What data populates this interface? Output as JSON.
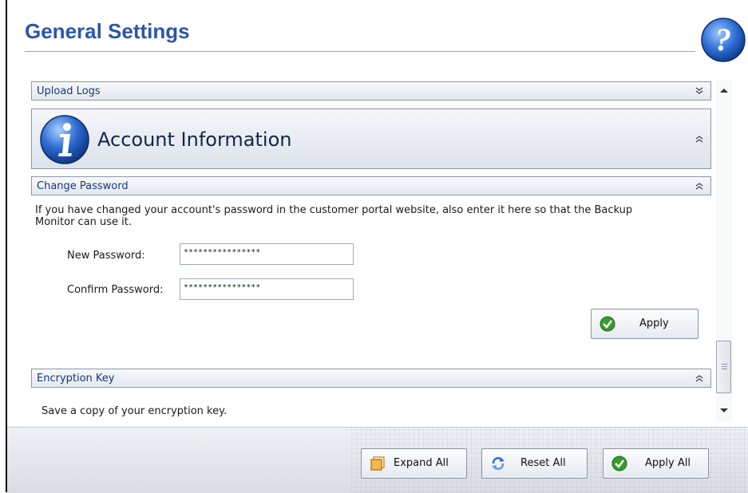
{
  "page": {
    "title": "General Settings"
  },
  "sections": {
    "upload_logs": {
      "label": "Upload Logs"
    },
    "account_info": {
      "label": "Account Information"
    },
    "change_password": {
      "label": "Change Password",
      "description_line1": "If you have changed your account's password in the customer portal website, also enter it here so that the Backup",
      "description_line2": "Monitor can use it.",
      "new_password_label": "New Password:",
      "new_password_value": "****************",
      "confirm_password_label": "Confirm Password:",
      "confirm_password_value": "****************",
      "apply_label": "Apply"
    },
    "encryption_key": {
      "label": "Encryption Key",
      "description": "Save a copy of your encryption key."
    }
  },
  "footer": {
    "expand_all": "Expand All",
    "reset_all": "Reset All",
    "apply_all": "Apply All"
  },
  "icons": {
    "help": "help-icon",
    "info": "info-icon",
    "apply": "checkmark-icon",
    "expand": "expand-icon",
    "reset": "reset-icon",
    "collapse": "chevron-up-double-icon",
    "expand_chev": "chevron-down-double-icon"
  },
  "colors": {
    "title": "#2b56a8",
    "header_text": "#143a78",
    "check_green": "#3a9a2e"
  }
}
